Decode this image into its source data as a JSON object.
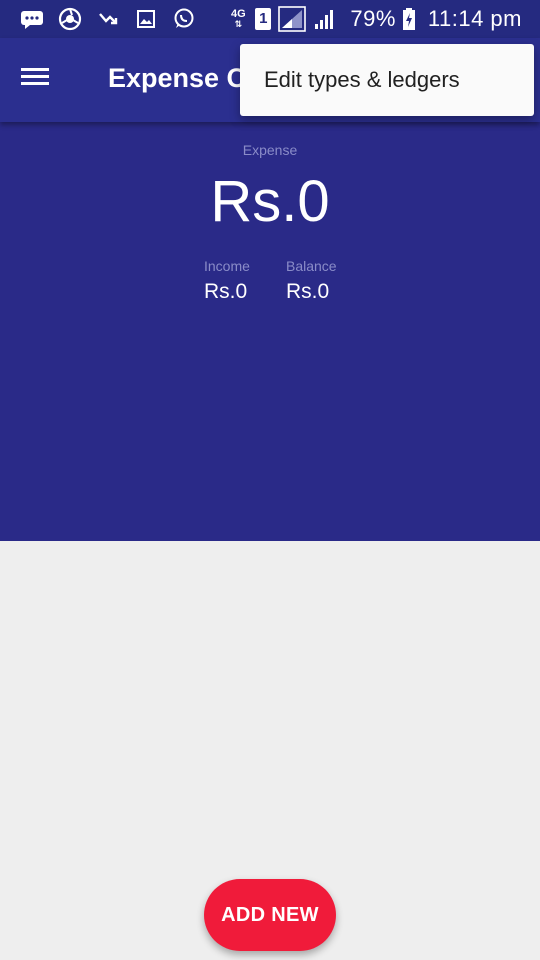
{
  "status_bar": {
    "network_type": "4G",
    "sim_slot": "1",
    "battery_percent": "79%",
    "time": "11:14 pm",
    "icons": [
      "messages-icon",
      "browser-icon",
      "missed-call-icon",
      "gallery-icon",
      "whatsapp-icon",
      "network-4g-icon",
      "sim-icon",
      "signal-icon",
      "signal-icon-2",
      "battery-charging-icon"
    ]
  },
  "app_bar": {
    "title": "Expense C",
    "menu_icon": "hamburger-menu-icon"
  },
  "summary": {
    "expense_label": "Expense",
    "expense_amount": "Rs.0",
    "income_label": "Income",
    "income_value": "Rs.0",
    "balance_label": "Balance",
    "balance_value": "Rs.0"
  },
  "overflow_menu": {
    "items": [
      {
        "label": "Edit types & ledgers"
      }
    ]
  },
  "fab": {
    "label": "ADD NEW"
  },
  "colors": {
    "status_bar": "#252a80",
    "app_bar": "#2b2f8f",
    "summary_bg": "#2a2a88",
    "content_bg": "#eeeeee",
    "fab": "#f01b3a"
  }
}
